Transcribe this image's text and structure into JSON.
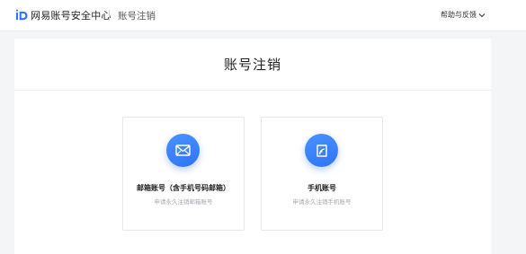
{
  "header": {
    "logo_text": "网易账号安全中心",
    "page_name": "账号注销",
    "help_label": "帮助与反馈",
    "accent_color": "#2f74f5"
  },
  "main": {
    "title": "账号注销",
    "options": [
      {
        "label": "邮箱账号（含手机号码邮箱）",
        "description": "申请永久注销邮箱账号",
        "icon": "envelope-icon"
      },
      {
        "label": "手机账号",
        "description": "申请永久注销手机账号",
        "icon": "phone-account-icon"
      }
    ]
  }
}
